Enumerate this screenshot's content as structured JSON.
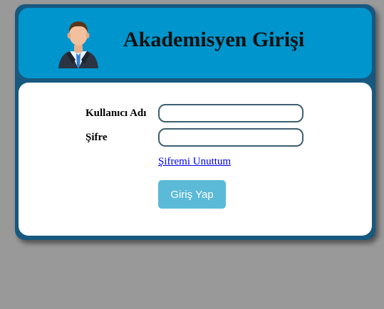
{
  "header": {
    "title": "Akademisyen Girişi",
    "avatar_icon": "user-avatar-icon"
  },
  "form": {
    "username_label": "Kullanıcı Adı",
    "username_value": "",
    "password_label": "Şifre",
    "password_value": "",
    "forgot_link": "Şifremi Unuttum",
    "submit_label": "Giriş Yap"
  },
  "colors": {
    "page_background": "#999999",
    "panel_border": "#17587f",
    "header_background": "#0095cc",
    "button_background": "#5bbad7",
    "link": "#0000ee"
  }
}
